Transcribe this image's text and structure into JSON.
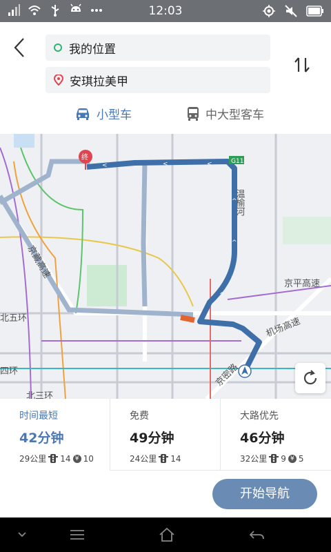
{
  "status_bar": {
    "time": "12:03",
    "left_icons": [
      "signal-icon",
      "wifi-icon",
      "usb-icon",
      "android-icon",
      "more-icon"
    ],
    "right_icons": [
      "location-icon",
      "mute-icon",
      "battery-icon"
    ]
  },
  "route_form": {
    "origin": "我的位置",
    "destination": "安琪拉美甲",
    "origin_color": "#2bb673",
    "destination_color": "#e0454f"
  },
  "vehicle_modes": [
    {
      "label": "小型车",
      "selected": true
    },
    {
      "label": "中大型客车",
      "selected": false
    }
  ],
  "map": {
    "labels": {
      "river": "温榆河",
      "expressway1": "京藏高速",
      "expressway2": "京平高速",
      "expressway3": "机场高速",
      "ring5": "北五环",
      "ring4": "四环",
      "ring3": "北三环",
      "jingmi": "京密路",
      "end_marker": "终",
      "road_shield": "G11"
    },
    "route_color": "#3f6fa8"
  },
  "routes": [
    {
      "name": "时间最短",
      "duration": "42分钟",
      "distance": "29公里",
      "lights": "14",
      "toll": "10",
      "selected": true
    },
    {
      "name": "免费",
      "duration": "49分钟",
      "distance": "24公里",
      "lights": "14",
      "toll": null,
      "selected": false
    },
    {
      "name": "大路优先",
      "duration": "46分钟",
      "distance": "32公里",
      "lights": "9",
      "toll": "5",
      "selected": false
    }
  ],
  "coin_symbol": "¥",
  "start_button": "开始导航"
}
